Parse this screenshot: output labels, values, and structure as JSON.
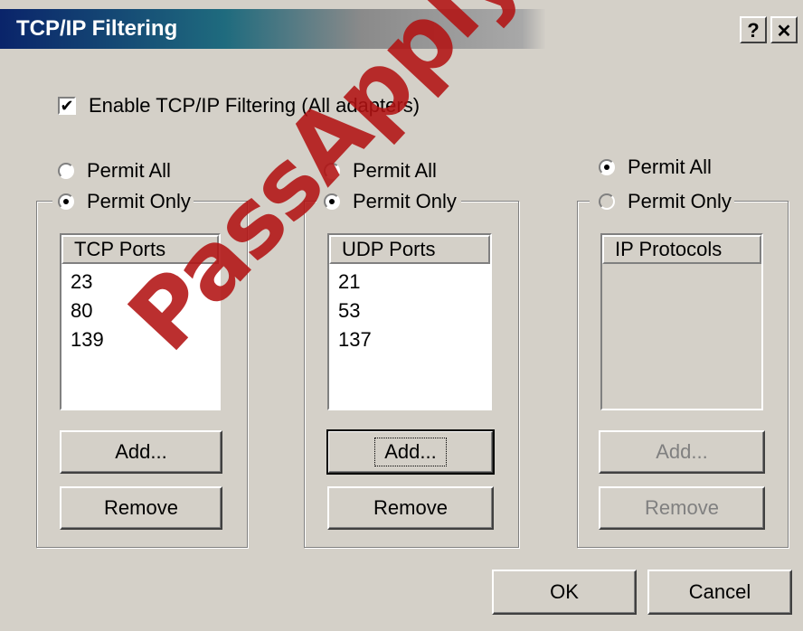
{
  "window": {
    "title": "TCP/IP Filtering",
    "help_button": "?",
    "close_button": "✕"
  },
  "enable_checkbox": {
    "label": "Enable TCP/IP Filtering (All adapters)",
    "checked": true,
    "check_glyph": "✔"
  },
  "tcp": {
    "permit_all": "Permit All",
    "permit_only": "Permit Only",
    "selected": "permit_only",
    "header": "TCP Ports",
    "ports": [
      "23",
      "80",
      "139"
    ],
    "add_button": "Add...",
    "remove_button": "Remove"
  },
  "udp": {
    "permit_all": "Permit All",
    "permit_only": "Permit Only",
    "selected": "permit_only",
    "header": "UDP Ports",
    "ports": [
      "21",
      "53",
      "137"
    ],
    "add_button": "Add...",
    "remove_button": "Remove"
  },
  "ip": {
    "permit_all": "Permit All",
    "permit_only": "Permit Only",
    "selected": "permit_all",
    "header": "IP Protocols",
    "protocols": [],
    "add_button": "Add...",
    "remove_button": "Remove"
  },
  "footer": {
    "ok_button": "OK",
    "cancel_button": "Cancel"
  },
  "watermark": "PassApply.com"
}
